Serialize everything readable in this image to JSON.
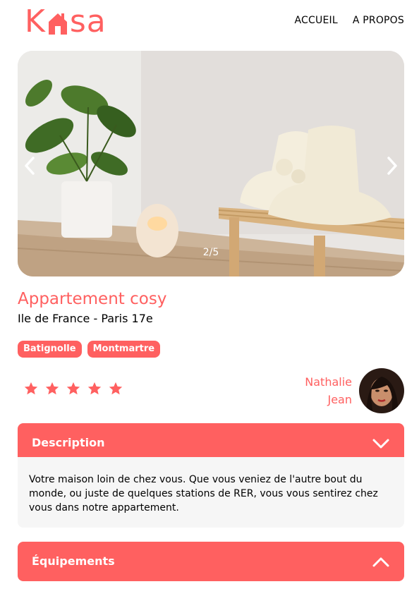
{
  "brand": {
    "logo_letters": [
      "K",
      "sa"
    ],
    "accent_color": "#FF6060"
  },
  "nav": {
    "items": [
      {
        "label": "ACCUEIL"
      },
      {
        "label": "A PROPOS"
      }
    ]
  },
  "carousel": {
    "counter": "2/5",
    "prev_icon": "chevron-left-icon",
    "next_icon": "chevron-right-icon"
  },
  "listing": {
    "title": "Appartement cosy",
    "location": "Ile de France - Paris 17e",
    "tags": [
      "Batignolle",
      "Montmartre"
    ],
    "rating": 5,
    "rating_max": 5,
    "host": {
      "first_name": "Nathalie",
      "last_name": "Jean"
    }
  },
  "collapses": {
    "description": {
      "label": "Description",
      "icon": "chevron-down-icon",
      "text": "Votre maison loin de chez vous. Que vous veniez de l'autre bout du monde, ou juste de quelques stations de RER, vous vous sentirez chez vous dans notre appartement."
    },
    "equipements": {
      "label": "Équipements",
      "icon": "chevron-up-icon"
    }
  }
}
